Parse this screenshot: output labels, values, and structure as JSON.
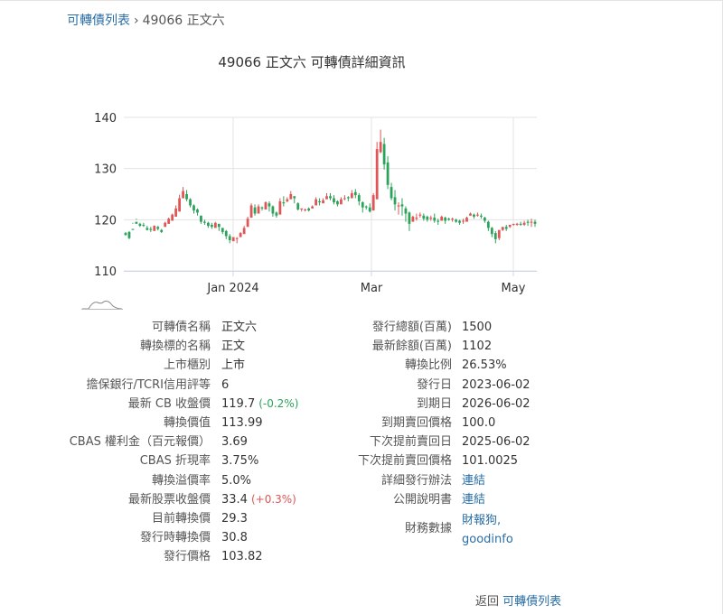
{
  "breadcrumb": {
    "list_link": "可轉債列表",
    "separator": "›",
    "current": "49066 正文六"
  },
  "page_title": "49066 正文六 可轉債詳細資訊",
  "chart_data": {
    "type": "candlestick",
    "x_tick_labels": [
      "Jan 2024",
      "Mar",
      "May"
    ],
    "y_ticks": [
      110,
      120,
      130,
      140
    ],
    "ylim": [
      110,
      140
    ],
    "grid": true,
    "colors": {
      "up": "#e05555",
      "down": "#2ca35a"
    },
    "candles": [
      [
        117.4,
        117.6,
        117.0,
        116.9
      ],
      [
        117.6,
        117.8,
        116.4,
        116.2
      ],
      [
        118.2,
        119.2,
        118.0,
        119.4
      ],
      [
        119.6,
        120.0,
        119.2,
        120.2
      ],
      [
        119.2,
        119.4,
        118.8,
        118.6
      ],
      [
        119.0,
        119.4,
        118.8,
        118.6
      ],
      [
        118.4,
        118.8,
        118.0,
        117.9
      ],
      [
        118.2,
        118.6,
        118.0,
        117.6
      ],
      [
        117.8,
        118.0,
        118.8,
        118.9
      ],
      [
        118.6,
        118.8,
        118.2,
        117.9
      ],
      [
        118.0,
        118.2,
        117.6,
        117.4
      ],
      [
        118.6,
        118.6,
        119.4,
        119.6
      ],
      [
        119.2,
        119.2,
        120.2,
        120.4
      ],
      [
        119.8,
        120.6,
        121.0,
        121.2
      ],
      [
        120.6,
        120.6,
        122.2,
        122.8
      ],
      [
        121.6,
        121.6,
        124.2,
        124.9
      ],
      [
        124.2,
        124.4,
        125.6,
        126.4
      ],
      [
        125.0,
        125.8,
        124.0,
        123.6
      ],
      [
        124.0,
        124.2,
        122.8,
        122.4
      ],
      [
        122.8,
        123.0,
        121.8,
        121.2
      ],
      [
        122.0,
        122.2,
        121.4,
        120.8
      ],
      [
        120.8,
        120.8,
        119.6,
        119.2
      ],
      [
        119.6,
        120.0,
        119.4,
        119.0
      ],
      [
        119.4,
        119.6,
        118.8,
        118.4
      ],
      [
        119.0,
        119.4,
        118.6,
        118.2
      ],
      [
        118.4,
        119.4,
        119.4,
        119.6
      ],
      [
        119.2,
        119.2,
        118.6,
        117.8
      ],
      [
        118.4,
        118.4,
        117.6,
        117.2
      ],
      [
        117.8,
        118.0,
        116.8,
        116.2
      ],
      [
        116.8,
        117.2,
        116.0,
        115.4
      ],
      [
        115.8,
        116.2,
        116.6,
        116.2
      ],
      [
        116.4,
        116.6,
        116.4,
        115.4
      ],
      [
        116.6,
        116.6,
        117.4,
        117.6
      ],
      [
        117.2,
        117.6,
        118.4,
        118.8
      ],
      [
        118.6,
        118.6,
        120.2,
        120.6
      ],
      [
        120.4,
        120.4,
        122.8,
        123.2
      ],
      [
        122.4,
        123.0,
        121.2,
        120.8
      ],
      [
        121.2,
        121.6,
        122.6,
        123.0
      ],
      [
        122.4,
        122.6,
        122.2,
        121.8
      ],
      [
        122.0,
        122.2,
        123.4,
        123.6
      ],
      [
        123.2,
        123.6,
        122.6,
        121.6
      ],
      [
        122.6,
        122.8,
        121.2,
        120.6
      ],
      [
        121.4,
        121.6,
        120.8,
        120.4
      ],
      [
        121.0,
        121.4,
        123.6,
        124.2
      ],
      [
        123.4,
        124.6,
        123.2,
        122.6
      ],
      [
        123.6,
        124.4,
        124.0,
        123.4
      ],
      [
        124.0,
        125.0,
        125.0,
        125.6
      ],
      [
        124.6,
        124.6,
        124.2,
        123.2
      ],
      [
        123.2,
        123.4,
        122.0,
        121.8
      ],
      [
        122.0,
        122.2,
        122.2,
        121.6
      ],
      [
        122.0,
        122.2,
        122.0,
        121.6
      ],
      [
        122.2,
        122.4,
        121.8,
        121.6
      ],
      [
        122.2,
        122.4,
        122.6,
        122.8
      ],
      [
        122.8,
        123.2,
        124.0,
        124.4
      ],
      [
        123.6,
        124.2,
        123.4,
        122.8
      ],
      [
        123.2,
        123.6,
        123.8,
        124.2
      ],
      [
        124.0,
        124.4,
        124.6,
        125.2
      ],
      [
        124.6,
        125.2,
        124.2,
        123.8
      ],
      [
        124.2,
        124.8,
        123.4,
        123.0
      ],
      [
        123.6,
        123.8,
        123.0,
        122.6
      ],
      [
        123.0,
        123.4,
        124.0,
        124.4
      ],
      [
        124.2,
        124.8,
        124.2,
        123.8
      ],
      [
        124.4,
        124.6,
        124.2,
        123.6
      ],
      [
        124.2,
        125.2,
        125.2,
        125.8
      ],
      [
        125.4,
        126.0,
        124.8,
        124.2
      ],
      [
        124.8,
        125.2,
        123.6,
        122.8
      ],
      [
        123.4,
        123.6,
        122.4,
        121.4
      ],
      [
        122.6,
        122.8,
        122.4,
        122.0
      ],
      [
        122.4,
        123.2,
        121.6,
        121.4
      ],
      [
        121.8,
        122.6,
        124.8,
        125.2
      ],
      [
        124.0,
        124.0,
        133.8,
        135.2
      ],
      [
        133.2,
        137.6,
        135.2,
        133.0
      ],
      [
        134.8,
        136.0,
        130.8,
        129.8
      ],
      [
        131.2,
        132.4,
        126.8,
        126.0
      ],
      [
        126.4,
        127.2,
        124.2,
        123.8
      ],
      [
        124.4,
        125.8,
        123.0,
        121.8
      ],
      [
        122.6,
        123.4,
        122.8,
        121.0
      ],
      [
        123.0,
        124.2,
        122.6,
        120.8
      ],
      [
        122.2,
        122.6,
        121.2,
        119.6
      ],
      [
        121.4,
        121.6,
        119.2,
        117.8
      ],
      [
        119.6,
        120.4,
        120.6,
        120.8
      ],
      [
        120.2,
        121.2,
        120.4,
        119.8
      ],
      [
        120.8,
        121.4,
        121.0,
        120.4
      ],
      [
        120.8,
        121.2,
        120.2,
        119.8
      ],
      [
        120.6,
        120.8,
        120.0,
        119.6
      ],
      [
        120.2,
        120.8,
        120.4,
        119.8
      ],
      [
        120.4,
        121.2,
        119.8,
        119.4
      ],
      [
        119.8,
        120.2,
        119.6,
        119.0
      ],
      [
        119.8,
        120.4,
        120.6,
        120.8
      ],
      [
        120.4,
        120.6,
        119.8,
        119.2
      ],
      [
        120.2,
        120.4,
        120.0,
        119.8
      ],
      [
        120.0,
        120.4,
        120.2,
        119.6
      ],
      [
        120.0,
        120.2,
        119.6,
        119.4
      ],
      [
        119.8,
        120.0,
        119.4,
        119.0
      ],
      [
        119.8,
        120.2,
        119.8,
        119.2
      ],
      [
        119.6,
        120.0,
        120.4,
        120.6
      ],
      [
        120.8,
        120.8,
        121.2,
        121.4
      ],
      [
        121.0,
        121.2,
        120.6,
        120.2
      ],
      [
        120.8,
        121.4,
        121.0,
        120.6
      ],
      [
        120.8,
        121.2,
        120.6,
        120.2
      ],
      [
        120.4,
        120.6,
        119.8,
        119.4
      ],
      [
        119.6,
        119.8,
        118.4,
        117.8
      ],
      [
        118.4,
        118.6,
        117.2,
        116.6
      ],
      [
        117.4,
        117.8,
        116.2,
        115.4
      ],
      [
        116.4,
        117.6,
        118.0,
        116.0
      ],
      [
        118.0,
        118.4,
        118.6,
        117.8
      ],
      [
        118.6,
        119.0,
        118.2,
        117.8
      ],
      [
        118.6,
        118.8,
        119.0,
        118.4
      ],
      [
        119.0,
        119.2,
        119.2,
        118.8
      ],
      [
        119.0,
        119.4,
        119.2,
        118.8
      ],
      [
        119.2,
        119.6,
        119.0,
        118.8
      ],
      [
        119.0,
        119.8,
        119.4,
        118.8
      ],
      [
        119.6,
        120.0,
        119.4,
        118.8
      ],
      [
        119.6,
        120.2,
        119.6,
        118.6
      ],
      [
        119.6,
        120.0,
        119.2,
        118.6
      ]
    ]
  },
  "details_left": [
    {
      "label": "可轉債名稱",
      "value": "正文六"
    },
    {
      "label": "轉換標的名稱",
      "value": "正文"
    },
    {
      "label": "上市櫃別",
      "value": "上市"
    },
    {
      "label": "擔保銀行/TCRI信用評等",
      "value": "6"
    },
    {
      "label": "最新 CB 收盤價",
      "value": "119.7",
      "change": "(-0.2%)",
      "change_dir": "down"
    },
    {
      "label": "轉換價值",
      "value": "113.99"
    },
    {
      "label": "CBAS 權利金（百元報價）",
      "value": "3.69"
    },
    {
      "label": "CBAS 折現率",
      "value": "3.75%"
    },
    {
      "label": "轉換溢價率",
      "value": "5.0%"
    },
    {
      "label": "最新股票收盤價",
      "value": "33.4",
      "change": "(+0.3%)",
      "change_dir": "up"
    },
    {
      "label": "目前轉換價",
      "value": "29.3"
    },
    {
      "label": "發行時轉換價",
      "value": "30.8"
    },
    {
      "label": "發行價格",
      "value": "103.82"
    }
  ],
  "details_right": [
    {
      "label": "發行總額(百萬)",
      "value": "1500"
    },
    {
      "label": "最新餘額(百萬)",
      "value": "1102"
    },
    {
      "label": "轉換比例",
      "value": "26.53%"
    },
    {
      "label": "發行日",
      "value": "2023-06-02"
    },
    {
      "label": "到期日",
      "value": "2026-06-02"
    },
    {
      "label": "到期賣回價格",
      "value": "100.0"
    },
    {
      "label": "下次提前賣回日",
      "value": "2025-06-02"
    },
    {
      "label": "下次提前賣回價格",
      "value": "101.0025"
    },
    {
      "label": "詳細發行辦法",
      "link": "連結"
    },
    {
      "label": "公開說明書",
      "link": "連結"
    }
  ],
  "financials": {
    "label": "財務數據",
    "link1": "財報狗,",
    "link2": "goodinfo"
  },
  "footer": {
    "back_text": "返回",
    "back_link": "可轉債列表"
  }
}
